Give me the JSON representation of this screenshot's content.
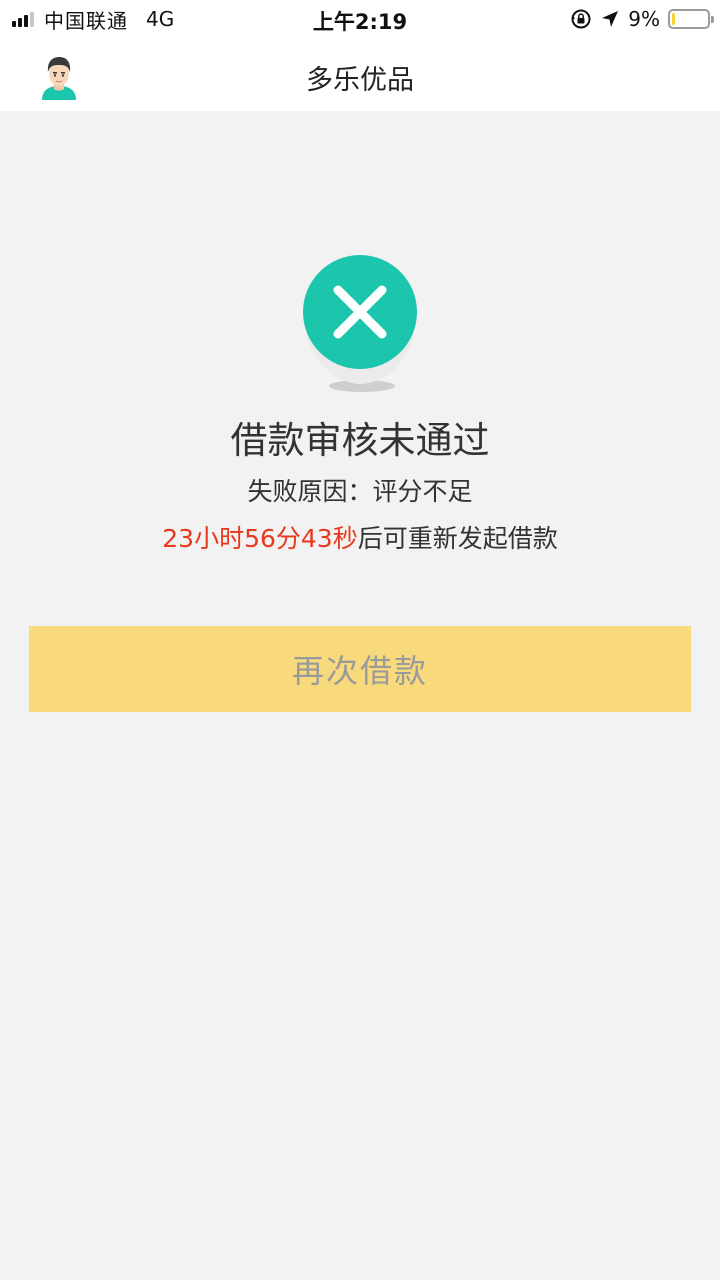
{
  "status_bar": {
    "carrier": "中国联通",
    "network": "4G",
    "time": "上午2:19",
    "battery_percent": "9%",
    "battery_level": 0.09,
    "icons": [
      "signal-icon",
      "rotation-lock-icon",
      "location-arrow-icon",
      "battery-icon"
    ]
  },
  "nav": {
    "title": "多乐优品",
    "avatar_icon": "user-avatar-icon"
  },
  "result": {
    "icon": "close-circle-icon",
    "icon_color": "#1cc6ad",
    "title": "借款审核未通过",
    "reason_label": "失败原因：",
    "reason_value": "评分不足",
    "countdown": "23小时56分43秒",
    "countdown_suffix": "后可重新发起借款",
    "countdown_color": "#e8391e"
  },
  "actions": {
    "retry_label": "再次借款",
    "retry_bg": "#f8da7c"
  }
}
